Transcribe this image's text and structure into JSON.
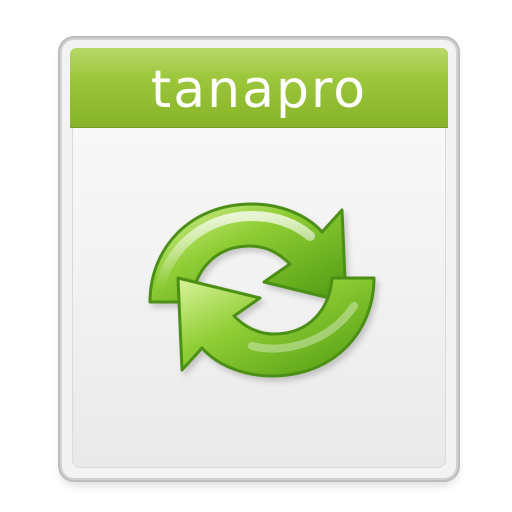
{
  "brand": {
    "label": "tanapro",
    "accent": "#96c23a",
    "accent_dark": "#5f9a12",
    "text_color": "#ffffff"
  },
  "icon": {
    "semantic_name": "sync-icon"
  }
}
